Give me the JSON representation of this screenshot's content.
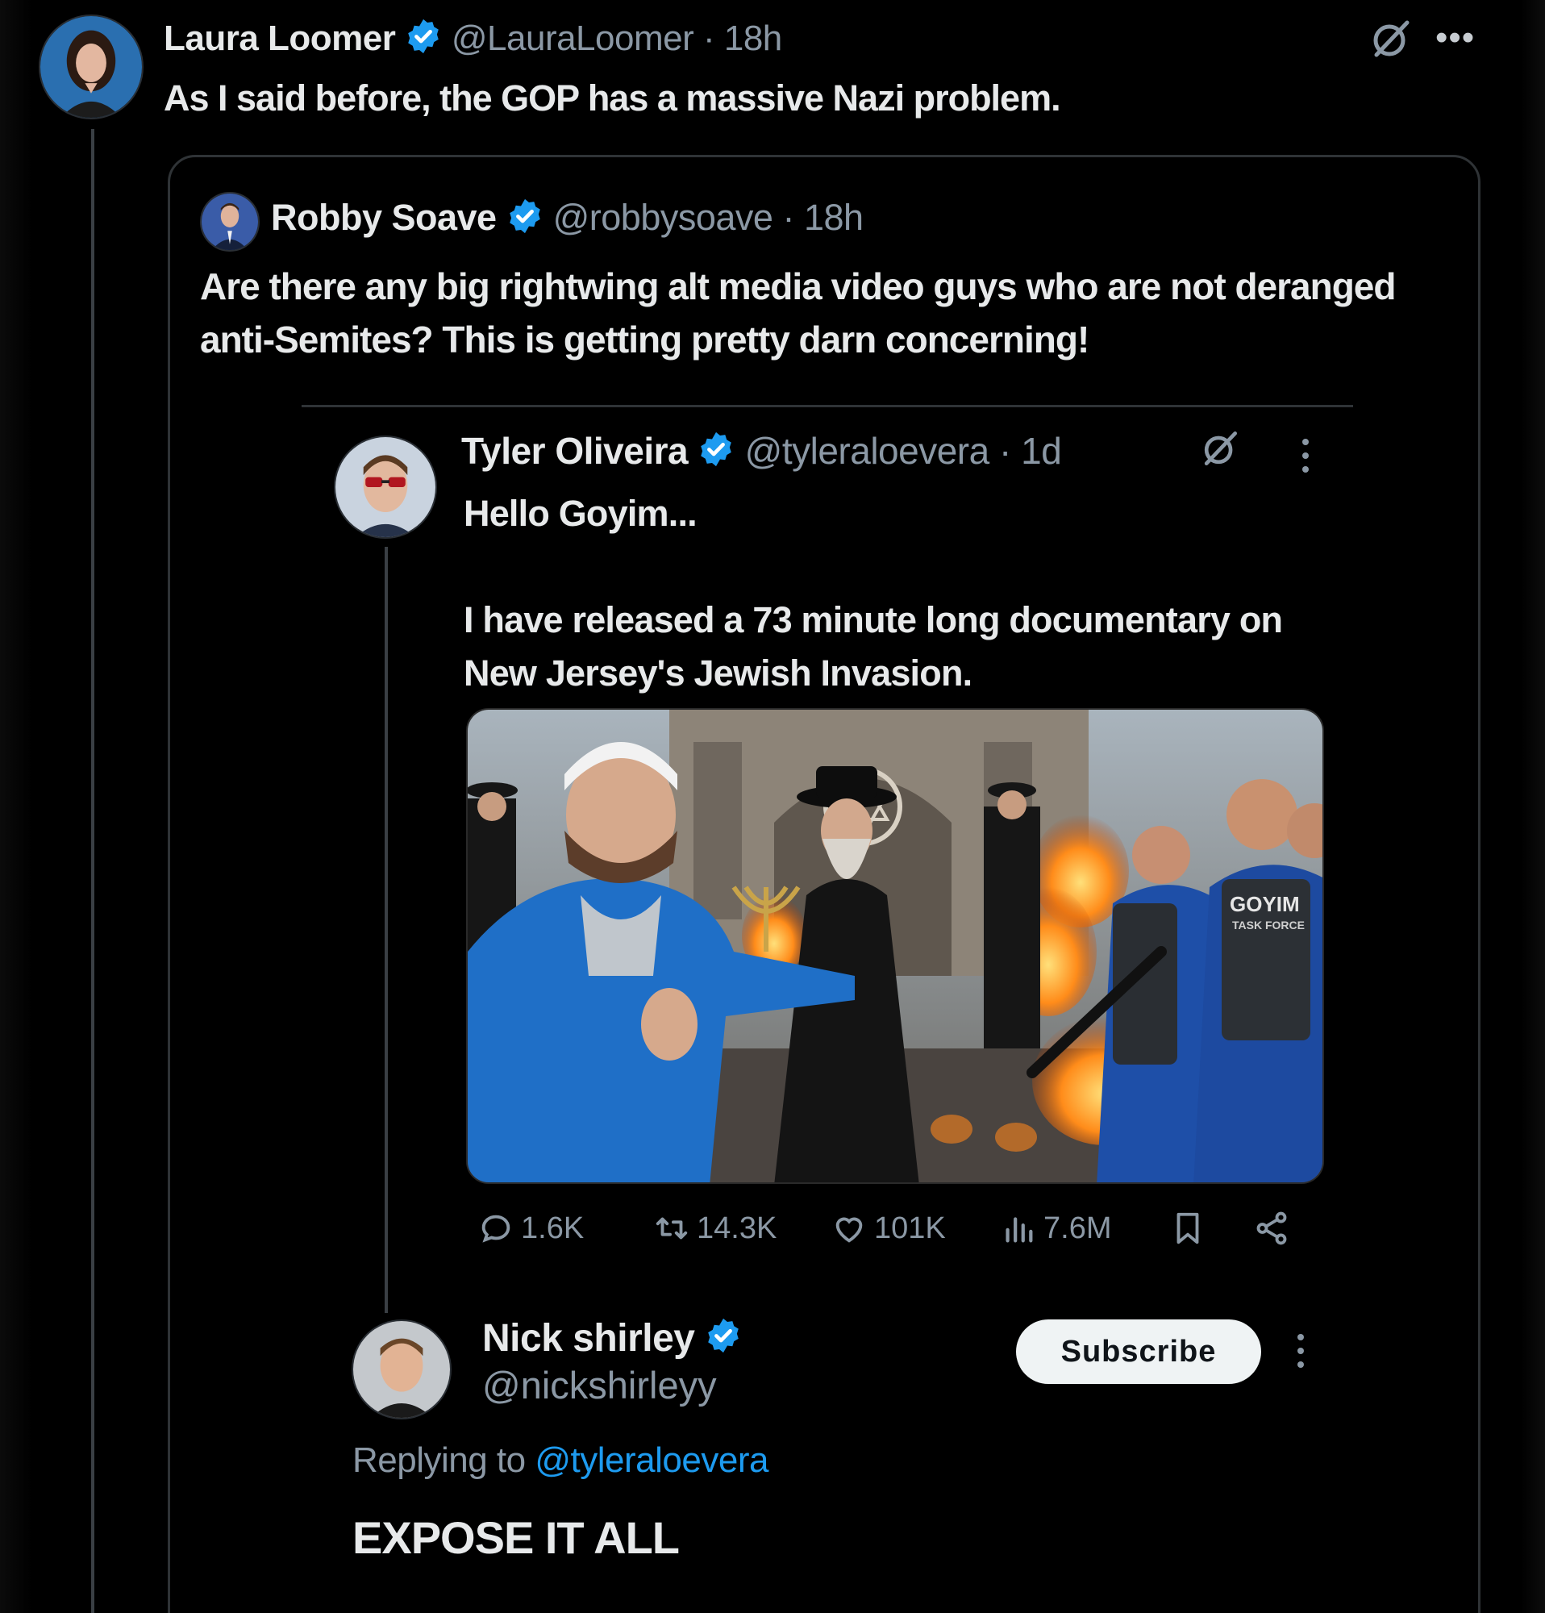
{
  "laura": {
    "name": "Laura Loomer",
    "handle": "@LauraLoomer",
    "time": "18h",
    "text": "As I said before, the GOP has a massive Nazi problem."
  },
  "robby": {
    "name": "Robby Soave",
    "handle": "@robbysoave",
    "time": "18h",
    "text": "Are there any big rightwing alt media video guys who are not deranged anti-Semites? This is getting pretty darn concerning!"
  },
  "tyler": {
    "name": "Tyler Oliveira",
    "handle": "@tyleraloevera",
    "time": "1d",
    "text": "Hello Goyim...\n\nI have released a 73 minute long documentary on New Jersey's Jewish Invasion.",
    "media_caption": "GOYIM TASK FORCE",
    "stats": {
      "replies": "1.6K",
      "reposts": "14.3K",
      "likes": "101K",
      "views": "7.6M"
    }
  },
  "nick": {
    "name": "Nick shirley",
    "handle": "@nickshirleyy",
    "subscribe_label": "Subscribe",
    "replying_prefix": "Replying to",
    "replying_handle": "@tyleraloevera",
    "text": "EXPOSE IT ALL"
  },
  "icons": {
    "verified_color": "#1d9bf0",
    "action_color": "#8b98a5"
  }
}
